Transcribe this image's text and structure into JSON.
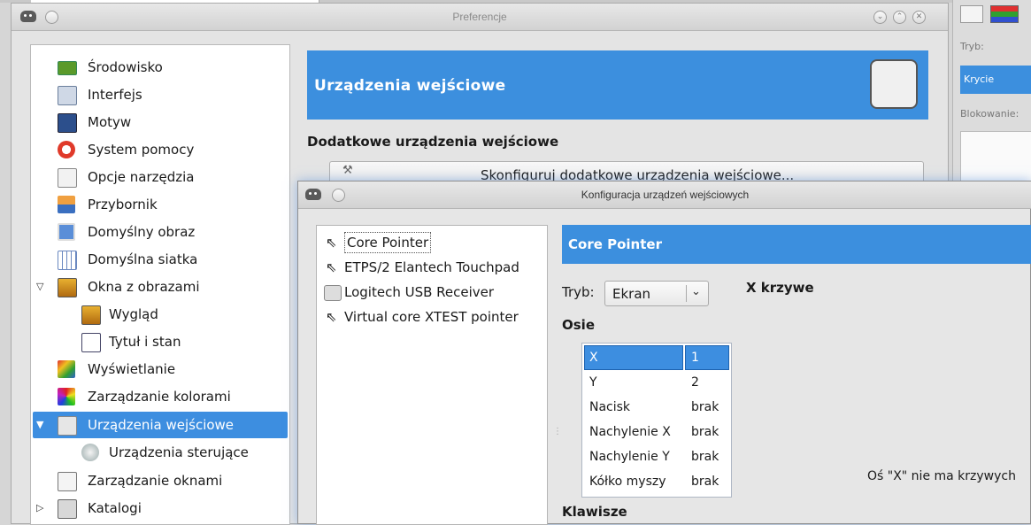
{
  "prefs": {
    "title": "Preferencje",
    "tree": [
      {
        "label": "Środowisko"
      },
      {
        "label": "Interfejs"
      },
      {
        "label": "Motyw"
      },
      {
        "label": "System pomocy"
      },
      {
        "label": "Opcje narzędzia"
      },
      {
        "label": "Przybornik"
      },
      {
        "label": "Domyślny obraz"
      },
      {
        "label": "Domyślna siatka"
      },
      {
        "label": "Okna z obrazami"
      },
      {
        "label": "Wygląd"
      },
      {
        "label": "Tytuł i stan"
      },
      {
        "label": "Wyświetlanie"
      },
      {
        "label": "Zarządzanie kolorami"
      },
      {
        "label": "Urządzenia wejściowe"
      },
      {
        "label": "Urządzenia sterujące"
      },
      {
        "label": "Zarządzanie oknami"
      },
      {
        "label": "Katalogi"
      }
    ],
    "header": "Urządzenia wejściowe",
    "section_title": "Dodatkowe urządzenia wejściowe",
    "configure_button": "Skonfiguruj dodatkowe urządzenia wejściowe..."
  },
  "right_dock": {
    "mode_label": "Tryb:",
    "mode_value": "Krycie",
    "lock_label": "Blokowanie:"
  },
  "input_dialog": {
    "title": "Konfiguracja urządzeń wejściowych",
    "devices": [
      {
        "label": "Core Pointer"
      },
      {
        "label": "ETPS/2 Elantech Touchpad"
      },
      {
        "label": "Logitech USB Receiver"
      },
      {
        "label": "Virtual core XTEST pointer"
      }
    ],
    "device_header": "Core Pointer",
    "mode_label": "Tryb:",
    "mode_value": "Ekran",
    "axes_title": "Osie",
    "axes": [
      {
        "name": "X",
        "value": "1"
      },
      {
        "name": "Y",
        "value": "2"
      },
      {
        "name": "Nacisk",
        "value": "brak"
      },
      {
        "name": "Nachylenie X",
        "value": "brak"
      },
      {
        "name": "Nachylenie Y",
        "value": "brak"
      },
      {
        "name": "Kółko myszy",
        "value": "brak"
      }
    ],
    "curves_title": "X krzywe",
    "curves_message": "Oś \"X\" nie ma krzywych",
    "keys_title": "Klawisze"
  },
  "colors": {
    "accent": "#3c8fde"
  }
}
